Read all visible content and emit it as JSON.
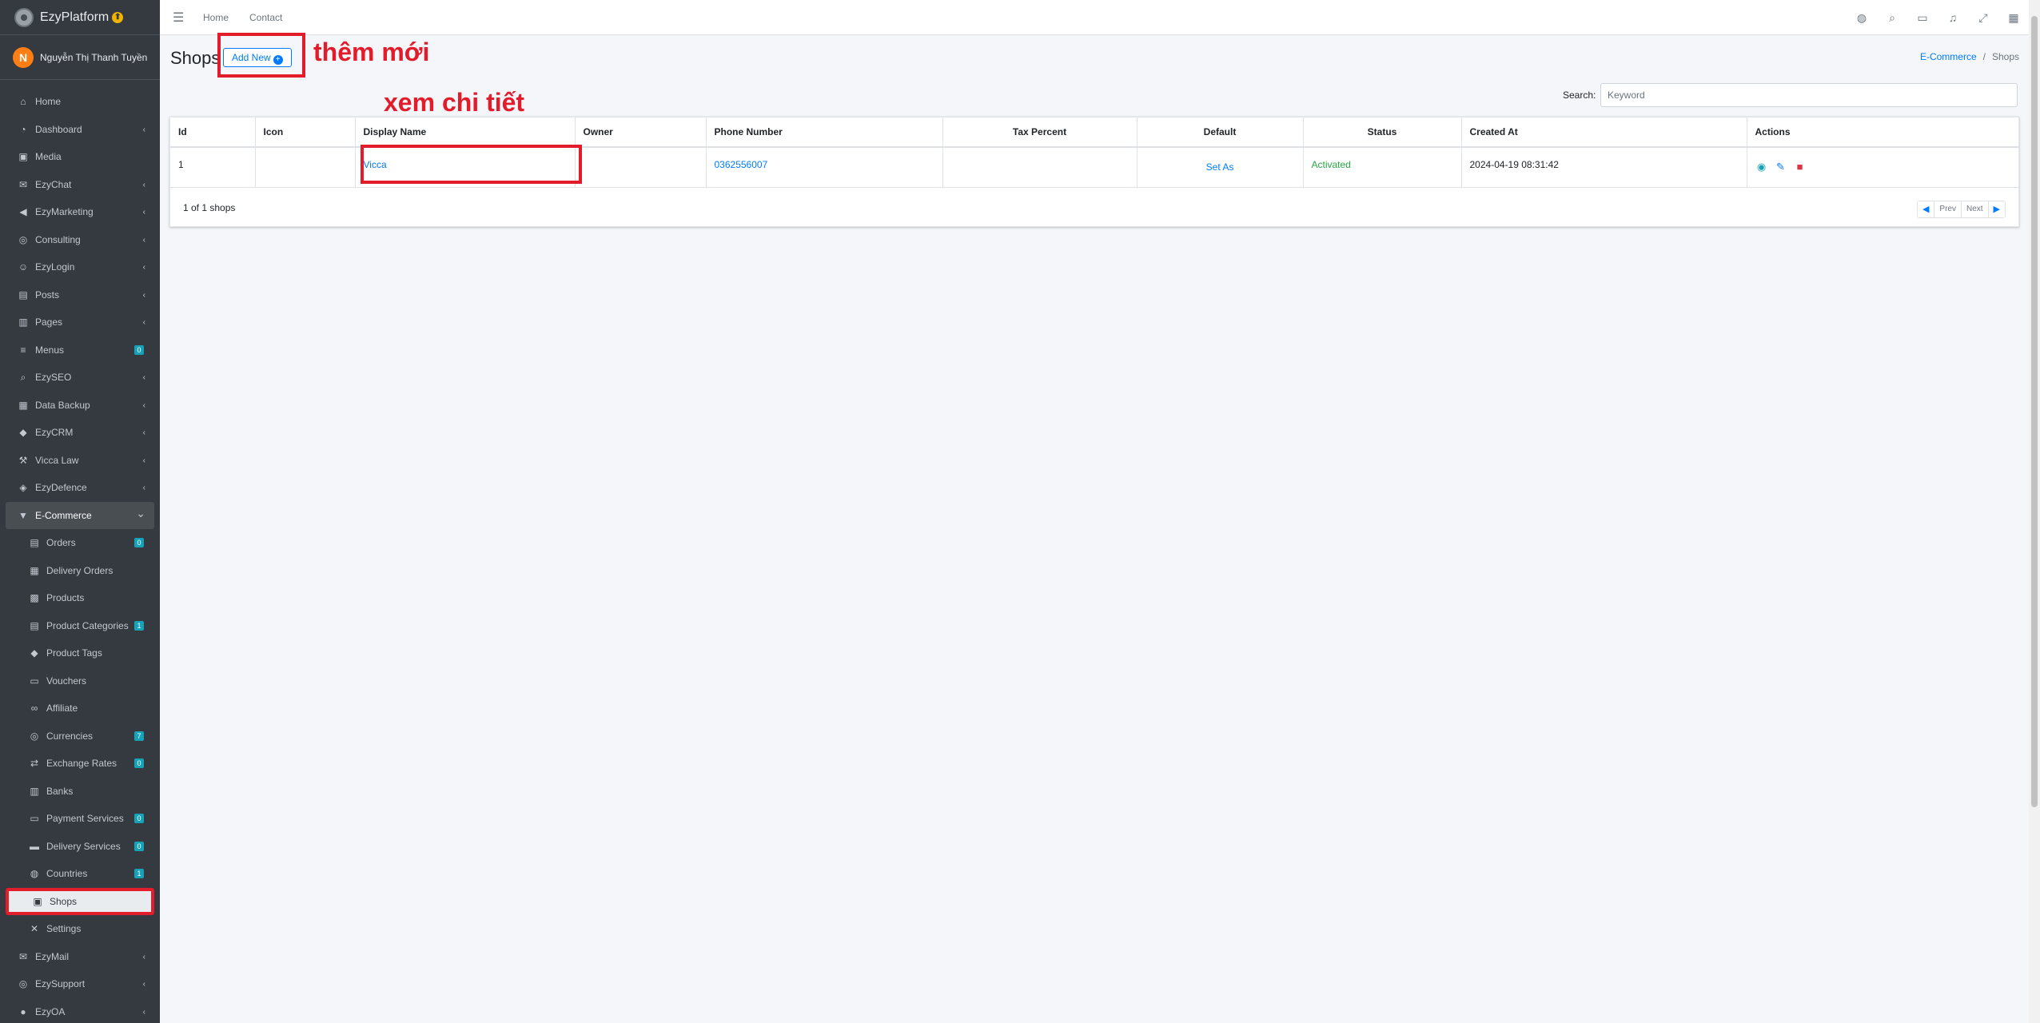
{
  "brand": {
    "name": "EzyPlatform",
    "badge": "⬆"
  },
  "user": {
    "initial": "N",
    "name": "Nguyễn Thị Thanh Tuyền"
  },
  "sidebar": {
    "items": [
      {
        "label": "Home",
        "icon": "home-icon",
        "chev": false
      },
      {
        "label": "Dashboard",
        "icon": "dashboard-icon",
        "chev": true
      },
      {
        "label": "Media",
        "icon": "media-icon",
        "chev": false
      },
      {
        "label": "EzyChat",
        "icon": "chat-icon",
        "chev": true
      },
      {
        "label": "EzyMarketing",
        "icon": "megaphone-icon",
        "chev": true
      },
      {
        "label": "Consulting",
        "icon": "consulting-icon",
        "chev": true
      },
      {
        "label": "EzyLogin",
        "icon": "login-icon",
        "chev": true
      },
      {
        "label": "Posts",
        "icon": "posts-icon",
        "chev": true
      },
      {
        "label": "Pages",
        "icon": "pages-icon",
        "chev": true
      },
      {
        "label": "Menus",
        "icon": "menu-icon",
        "badge": "0"
      },
      {
        "label": "EzySEO",
        "icon": "seo-icon",
        "chev": true
      },
      {
        "label": "Data Backup",
        "icon": "backup-icon",
        "chev": true
      },
      {
        "label": "EzyCRM",
        "icon": "crm-icon",
        "chev": true
      },
      {
        "label": "Vicca Law",
        "icon": "gavel-icon",
        "chev": true
      },
      {
        "label": "EzyDefence",
        "icon": "shield-icon",
        "chev": true
      },
      {
        "label": "E-Commerce",
        "icon": "basket-icon",
        "chev": "down"
      }
    ],
    "subitems": [
      {
        "label": "Orders",
        "icon": "orders-icon",
        "badge": "0"
      },
      {
        "label": "Delivery Orders",
        "icon": "delivery-orders-icon"
      },
      {
        "label": "Products",
        "icon": "products-icon"
      },
      {
        "label": "Product Categories",
        "icon": "categories-icon",
        "badge": "1"
      },
      {
        "label": "Product Tags",
        "icon": "tags-icon"
      },
      {
        "label": "Vouchers",
        "icon": "voucher-icon"
      },
      {
        "label": "Affiliate",
        "icon": "link-icon"
      },
      {
        "label": "Currencies",
        "icon": "currency-icon",
        "badge": "7"
      },
      {
        "label": "Exchange Rates",
        "icon": "exchange-icon",
        "badge": "0"
      },
      {
        "label": "Banks",
        "icon": "bank-icon"
      },
      {
        "label": "Payment Services",
        "icon": "payment-icon",
        "badge": "0"
      },
      {
        "label": "Delivery Services",
        "icon": "truck-icon",
        "badge": "0"
      },
      {
        "label": "Countries",
        "icon": "globe-icon",
        "badge": "1"
      },
      {
        "label": "Shops",
        "icon": "shop-icon",
        "current": true
      },
      {
        "label": "Settings",
        "icon": "tools-icon"
      }
    ],
    "tail": [
      {
        "label": "EzyMail",
        "icon": "mail-icon",
        "chev": true
      },
      {
        "label": "EzySupport",
        "icon": "support-icon",
        "chev": true
      },
      {
        "label": "EzyOA",
        "icon": "oa-icon",
        "chev": true
      }
    ]
  },
  "topnav": {
    "home": "Home",
    "contact": "Contact"
  },
  "page": {
    "title": "Shops",
    "add_new": "Add New",
    "annot_new": "thêm mới",
    "annot_detail": "xem chi tiết",
    "breadcrumb": {
      "parent": "E-Commerce",
      "current": "Shops"
    }
  },
  "search": {
    "label": "Search:",
    "placeholder": "Keyword",
    "value": ""
  },
  "table": {
    "headers": [
      "Id",
      "Icon",
      "Display Name",
      "Owner",
      "Phone Number",
      "Tax Percent",
      "Default",
      "Status",
      "Created At",
      "Actions"
    ],
    "rows": [
      {
        "id": "1",
        "icon": "",
        "display_name": "Vicca",
        "owner": "",
        "phone": "0362556007",
        "tax": "",
        "default": "Set As",
        "status": "Activated",
        "created_at": "2024-04-19 08:31:42"
      }
    ]
  },
  "footer": {
    "count": "1 of 1 shops",
    "prev": "Prev",
    "next": "Next"
  },
  "colors": {
    "sidebar": "#343a40",
    "accent": "#007bff",
    "annotation": "#e21c2a",
    "success": "#28a745"
  }
}
